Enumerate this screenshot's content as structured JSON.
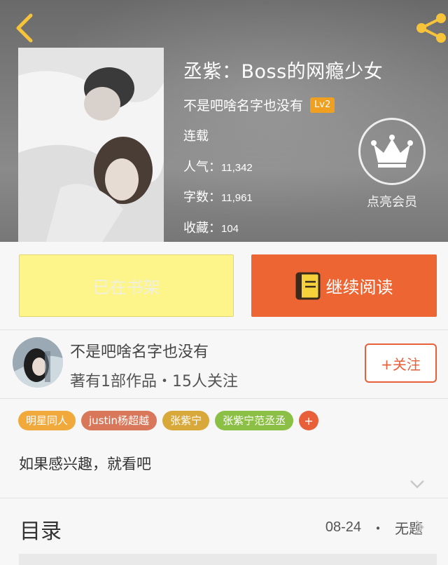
{
  "header": {
    "book_title": "丞紫：Boss的网瘾少女",
    "author": "不是吧啥名字也没有",
    "level_badge": "Lv2",
    "status": "连载",
    "stats": {
      "popularity_label": "人气：",
      "popularity_value": "11,342",
      "word_count_label": "字数：",
      "word_count_value": "11,961",
      "favorites_label": "收藏：",
      "favorites_value": "104"
    },
    "vip_label": "点亮会员"
  },
  "actions": {
    "shelf_label": "已在书架",
    "read_label": "继续阅读"
  },
  "author_section": {
    "name": "不是吧啥名字也没有",
    "meta": "著有1部作品・15人关注",
    "follow_label": "+关注"
  },
  "tags": [
    {
      "label": "明星同人",
      "color": "#f2a93b"
    },
    {
      "label": "justin杨超越",
      "color": "#d9775a"
    },
    {
      "label": "张紫宁",
      "color": "#d9a83a"
    },
    {
      "label": "张紫宁范丞丞",
      "color": "#8cbf45"
    }
  ],
  "tag_more": {
    "label": "+",
    "color": "#e8603a"
  },
  "description": "如果感兴趣，就看吧",
  "toc": {
    "title": "目录",
    "latest_date": "08-24",
    "separator": "・",
    "latest_chapter": "无题"
  },
  "colors": {
    "accent_orange": "#ee6534",
    "shelf_yellow": "#fdf58a",
    "badge_orange": "#f0a020"
  },
  "icons": [
    "back-icon",
    "share-icon",
    "crown-icon",
    "book-icon",
    "chevron-down-icon",
    "chevron-right-icon"
  ]
}
